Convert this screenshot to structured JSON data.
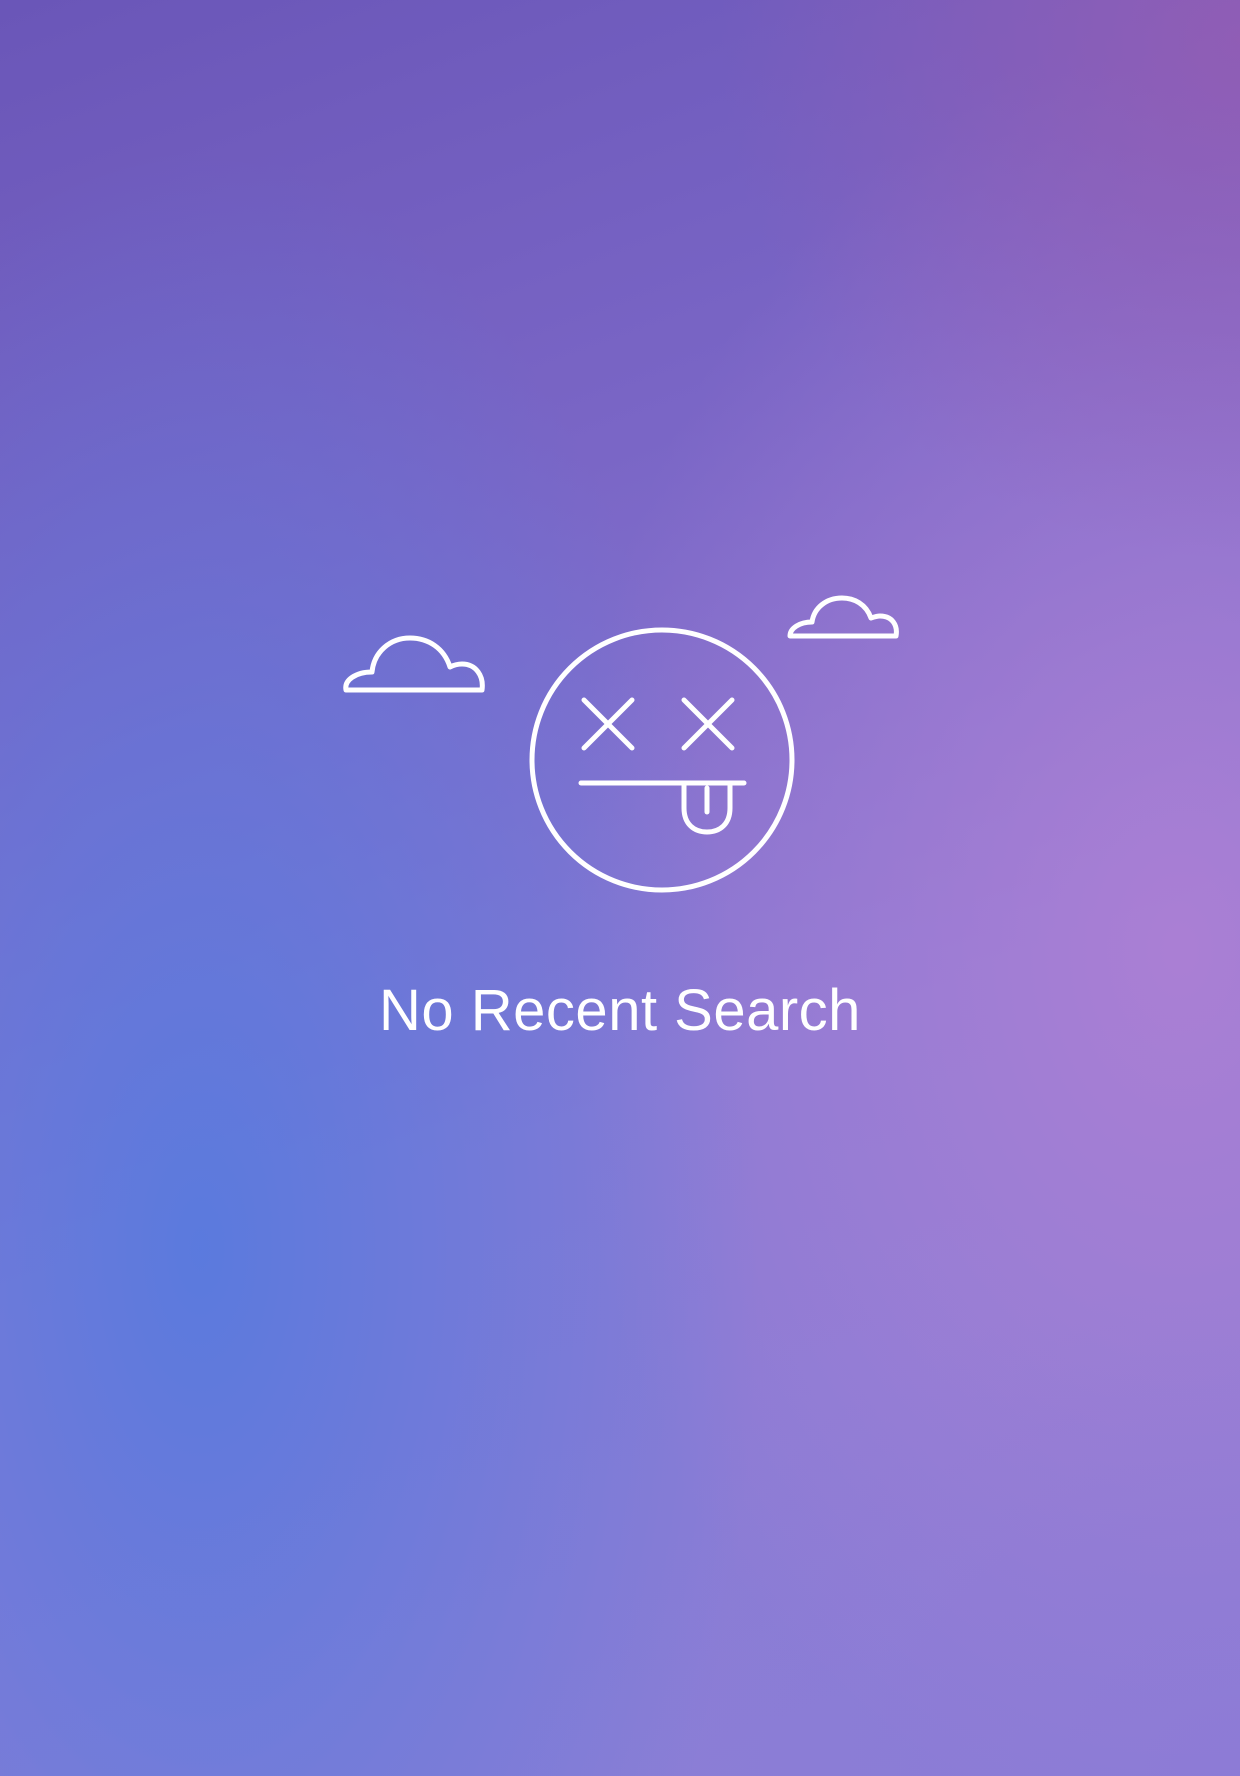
{
  "empty_state": {
    "message": "No Recent Search",
    "illustration_icon": "dizzy-face-tongue-icon",
    "decoration_icons": [
      "cloud-icon",
      "cloud-icon"
    ]
  },
  "colors": {
    "gradient_blue": "#5b7ad9",
    "gradient_purple": "#a77dd0",
    "gradient_deep_purple": "#6a54b6",
    "foreground": "#ffffff"
  }
}
